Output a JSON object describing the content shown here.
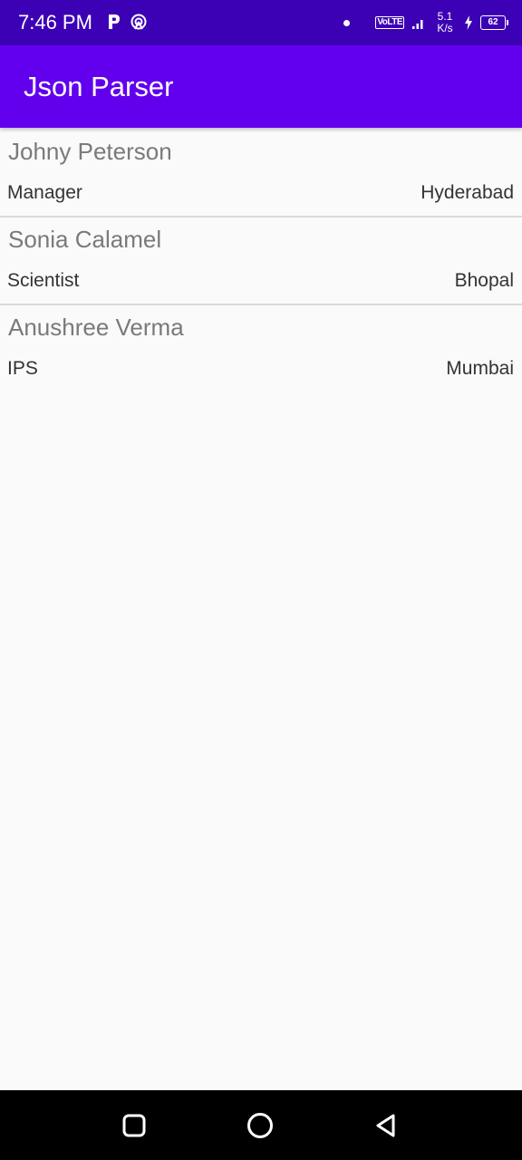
{
  "status_bar": {
    "time": "7:46 PM",
    "volte": "VoLTE",
    "speed_value": "5.1",
    "speed_unit": "K/s",
    "battery": "62"
  },
  "app_bar": {
    "title": "Json Parser"
  },
  "employees": [
    {
      "name": "Johny Peterson",
      "role": "Manager",
      "city": "Hyderabad"
    },
    {
      "name": "Sonia Calamel",
      "role": "Scientist",
      "city": "Bhopal"
    },
    {
      "name": "Anushree Verma",
      "role": "IPS",
      "city": "Mumbai"
    }
  ],
  "nav_bar": {
    "icons": [
      "recents-square-icon",
      "home-circle-icon",
      "back-triangle-icon"
    ]
  },
  "colors": {
    "status_bar": "#3d01b5",
    "app_bar": "#6200ee",
    "background": "#fafafa"
  }
}
